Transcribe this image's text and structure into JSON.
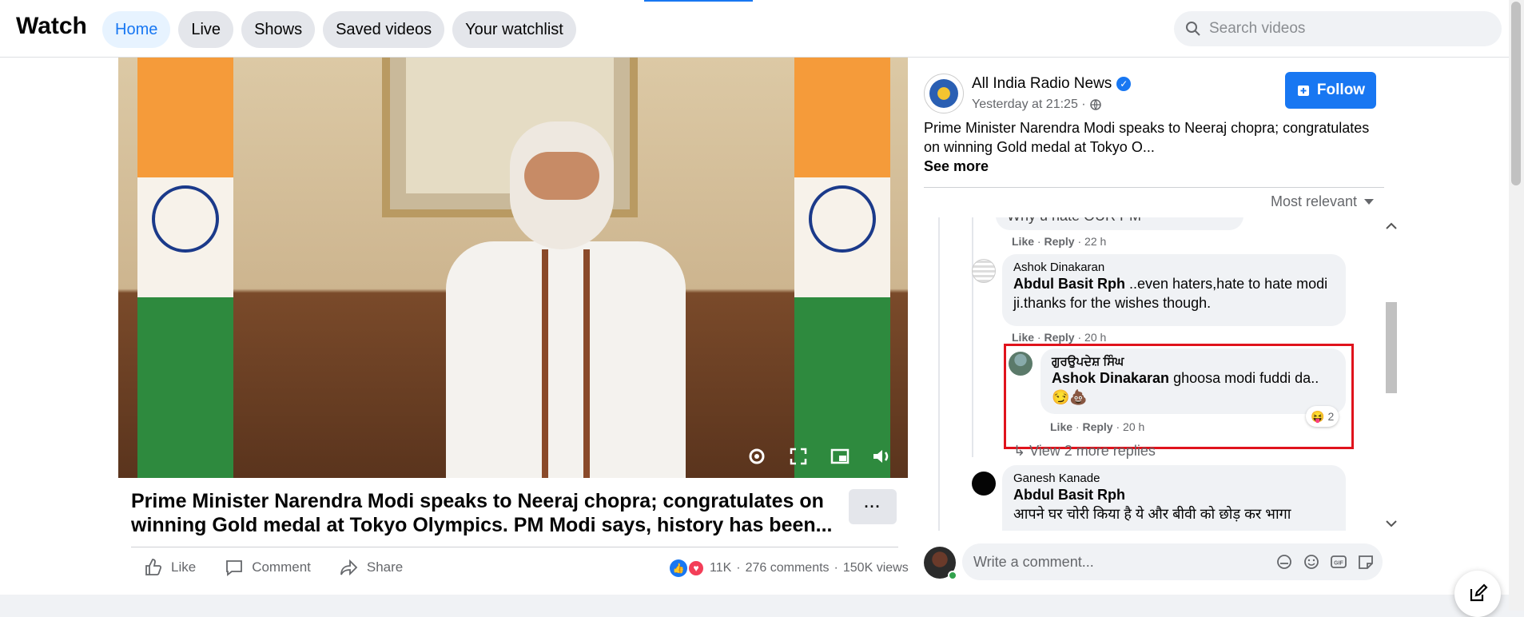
{
  "header": {
    "brand": "Watch",
    "tabs": [
      {
        "label": "Home",
        "active": true
      },
      {
        "label": "Live"
      },
      {
        "label": "Shows"
      },
      {
        "label": "Saved videos"
      },
      {
        "label": "Your watchlist"
      }
    ],
    "search_placeholder": "Search videos"
  },
  "video": {
    "title": "Prime Minister Narendra Modi speaks to Neeraj chopra; congratulates on winning Gold medal at Tokyo Olympics. PM Modi says, history has been...",
    "more_label": "···"
  },
  "actions": {
    "like": "Like",
    "comment": "Comment",
    "share": "Share"
  },
  "stats": {
    "reactions": "11K",
    "comments": "276 comments",
    "views": "150K views",
    "separator": "·"
  },
  "post": {
    "page_name": "All India Radio News",
    "time": "Yesterday at 21:25 ·",
    "follow_label": "Follow",
    "description": "Prime Minister Narendra Modi speaks to Neeraj chopra; congratulates on winning Gold medal at Tokyo O...",
    "see_more": "See more",
    "sort_label": "Most relevant"
  },
  "comments": {
    "c0": {
      "text": "Why u hate OUR PM",
      "meta_like": "Like",
      "meta_reply": "Reply",
      "meta_time": "22 h"
    },
    "c1": {
      "name": "Ashok Dinakaran",
      "mention": "Abdul Basit Rph",
      "text": " ..even haters,hate to hate modi ji.thanks for the wishes though.",
      "meta_like": "Like",
      "meta_reply": "Reply",
      "meta_time": "20 h"
    },
    "c2": {
      "name": "ਗੁਰਉਪਦੇਸ਼ ਸਿੰਘ",
      "mention": "Ashok Dinakaran",
      "text": " ghoosa modi fuddi da..",
      "emoji": "😏💩",
      "reaction_count": "2",
      "meta_like": "Like",
      "meta_reply": "Reply",
      "meta_time": "20 h"
    },
    "view_more": "View 2 more replies",
    "c3": {
      "name": "Ganesh Kanade",
      "mention": "Abdul Basit Rph",
      "text": "आपने घर चोरी किया है ये और बीवी को छोड़ कर भागा"
    }
  },
  "write": {
    "placeholder": "Write a comment..."
  },
  "colors": {
    "accent": "#1877f2",
    "highlight": "#e0131c"
  }
}
